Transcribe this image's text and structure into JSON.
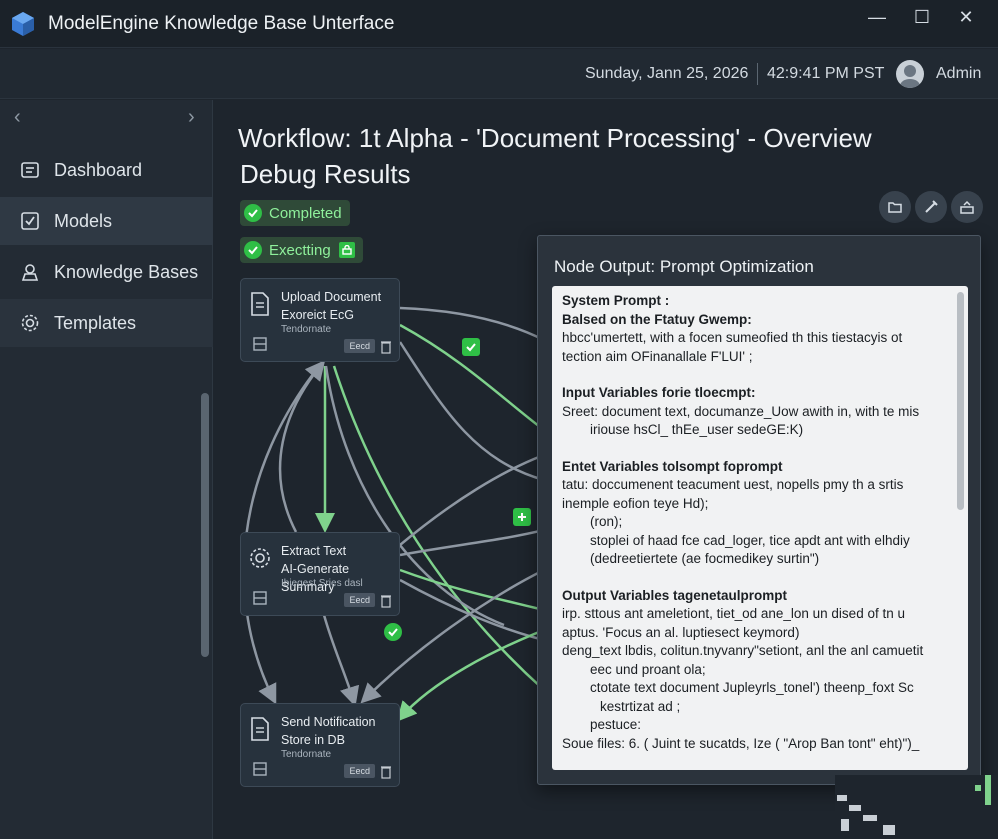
{
  "window": {
    "title": "ModelEngine Knowledge Base Unterface",
    "controls": {
      "minimize": "—",
      "maximize": "☐",
      "close": "✕"
    }
  },
  "header": {
    "date": "Sunday, Jann 25, 2026",
    "time": "42:9:41 PM PST",
    "user": "Admin"
  },
  "sidebar": {
    "items": [
      {
        "label": "Dashboard",
        "icon": "dashboard-icon"
      },
      {
        "label": "Models",
        "icon": "checkbox-icon"
      },
      {
        "label": "Knowledge Bases",
        "icon": "person-icon"
      },
      {
        "label": "Templates",
        "icon": "gear-icon"
      }
    ]
  },
  "main": {
    "title": "Workflow: 1t Alpha - 'Document Processing' - Overview",
    "subtitle": "Debug Results",
    "status_completed": "Completed",
    "status_executing": "Exectting"
  },
  "nodes": [
    {
      "line1": "Upload Document",
      "line2": "Exoreict EcG",
      "sub": "Tendornate",
      "chip": "Eecd",
      "icon": "document-icon"
    },
    {
      "line1": "Extract Text",
      "line2": "AI-Generate Summary",
      "sub": "Ibiegest Sries dasl",
      "chip": "Eecd",
      "icon": "gear-icon"
    },
    {
      "line1": "Send Notification",
      "line2": "Store in DB",
      "sub": "Tendornate",
      "chip": "Eecd",
      "icon": "document-icon"
    }
  ],
  "panel": {
    "title": "Node Output: Prompt Optimization",
    "system": {
      "head": "System Prompt :",
      "line1": "Balsed on the Ftatuy Gwemp:",
      "line2": "hbcc'umertett, with a focen sumeofied th this tiestacyis ot",
      "line3": "tection aim OFinanallale F'LUI' ;"
    },
    "input": {
      "head": "Input Variables forie tloecmpt:",
      "line1": "Sreet: document text, documanze_Uow awith in, with te mis",
      "line2": "iriouse hsCl_ thEe_user sedeGE:K)"
    },
    "extra": {
      "head": "Entet Variables tolsompt foprompt",
      "line1": "tatu: doccumenent teacument uest, nopells pmy th a srtis",
      "line2": "inemple eofion teye Hd);",
      "line3": "(ron);",
      "line4": "stoplei of haad fce cad_loger, tice apdt ant with elhdiy",
      "line5": "(dedreetiertete (ae focmedikey surtin\")"
    },
    "output": {
      "head": "Output Variables tagenetaulprompt",
      "line1": "irp. sttous ant ameletiont, tiet_od ane_lon un dised of tn u",
      "line2": "aptus. 'Focus an al. luptiesect keymord)",
      "line3": "deng_text lbdis, colitun.tnyvanry\"setiont, anl the anl camuetit",
      "line4": "eec und proant ola;",
      "line5": "ctotate text document Jupleyrls_tonel') theenp_foxt Sc",
      "line6": "kestrtizat ad ;",
      "line7": "pestuce:",
      "line8": "Soue files: 6. ( Juint te sucatds, Ize ( \"Arop Ban tont\" eht)\")_"
    }
  },
  "colors": {
    "accent_green": "#2fbf46",
    "edge_green": "#7fd28c",
    "edge_gray": "#8e97a2",
    "background": "#1e252d"
  }
}
